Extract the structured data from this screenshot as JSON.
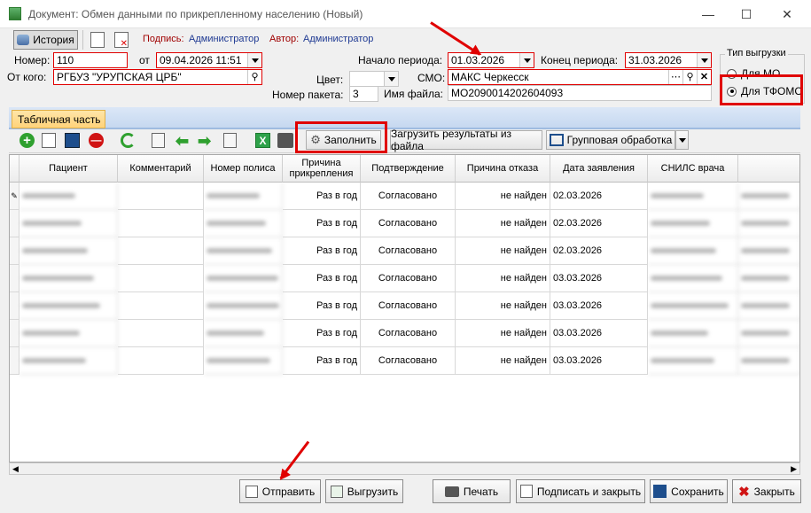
{
  "window": {
    "title": "Документ: Обмен данными по прикрепленному населению (Новый)"
  },
  "toolbar": {
    "history_label": "История",
    "signature_label": "Подпись:",
    "signature_value": "Администратор",
    "author_label": "Автор:",
    "author_value": "Администратор"
  },
  "header": {
    "number_label": "Номер:",
    "number_value": "110",
    "from_label": "от",
    "date_value": "09.04.2026 11:51",
    "sender_label": "От кого:",
    "sender_value": "РГБУЗ \"УРУПСКАЯ ЦРБ\"",
    "period_start_label": "Начало периода:",
    "period_start_value": "01.03.2026",
    "period_end_label": "Конец периода:",
    "period_end_value": "31.03.2026",
    "color_label": "Цвет:",
    "color_value": "",
    "smo_label": "СМО:",
    "smo_value": "МАКС Черкесск",
    "packet_label": "Номер пакета:",
    "packet_value": "3",
    "filename_label": "Имя файла:",
    "filename_value": "МО2090014202604093"
  },
  "export_type": {
    "legend": "Тип выгрузки",
    "options": [
      "Для МО",
      "Для ТФОМС"
    ],
    "selected": "Для ТФОМС"
  },
  "tabs": {
    "table_part": "Табличная часть"
  },
  "grid_toolbar": {
    "fill_label": "Заполнить",
    "load_results_label": "Загрузить результаты из файла",
    "group_processing_label": "Групповая обработка"
  },
  "table": {
    "columns": [
      "Пациент",
      "Комментарий",
      "Номер полиса",
      "Причина прикрепления",
      "Подтверждение",
      "Причина отказа",
      "Дата заявления",
      "СНИЛС врача"
    ],
    "rows": [
      {
        "patient": "Сулова Дарья",
        "comment": "",
        "policy": "",
        "reason": "Раз в год",
        "confirm": "Согласовано",
        "refusal": "не найден",
        "date": "02.03.2026",
        "snils": ""
      },
      {
        "patient": "",
        "comment": "",
        "policy": "",
        "reason": "Раз в год",
        "confirm": "Согласовано",
        "refusal": "не найден",
        "date": "02.03.2026",
        "snils": ""
      },
      {
        "patient": "",
        "comment": "",
        "policy": "",
        "reason": "Раз в год",
        "confirm": "Согласовано",
        "refusal": "не найден",
        "date": "02.03.2026",
        "snils": ""
      },
      {
        "patient": "",
        "comment": "",
        "policy": "",
        "reason": "Раз в год",
        "confirm": "Согласовано",
        "refusal": "не найден",
        "date": "03.03.2026",
        "snils": ""
      },
      {
        "patient": "",
        "comment": "",
        "policy": "",
        "reason": "Раз в год",
        "confirm": "Согласовано",
        "refusal": "не найден",
        "date": "03.03.2026",
        "snils": ""
      },
      {
        "patient": "",
        "comment": "",
        "policy": "",
        "reason": "Раз в год",
        "confirm": "Согласовано",
        "refusal": "не найден",
        "date": "03.03.2026",
        "snils": ""
      },
      {
        "patient": "",
        "comment": "",
        "policy": "",
        "reason": "Раз в год",
        "confirm": "Согласовано",
        "refusal": "не найден",
        "date": "03.03.2026",
        "snils": ""
      }
    ]
  },
  "footer": {
    "send_label": "Отправить",
    "upload_label": "Выгрузить",
    "print_label": "Печать",
    "sign_close_label": "Подписать и закрыть",
    "save_label": "Сохранить",
    "close_label": "Закрыть"
  },
  "colors": {
    "annotation_red": "#e00000",
    "link_blue": "#1f3a93",
    "signature_red": "#a00000"
  }
}
